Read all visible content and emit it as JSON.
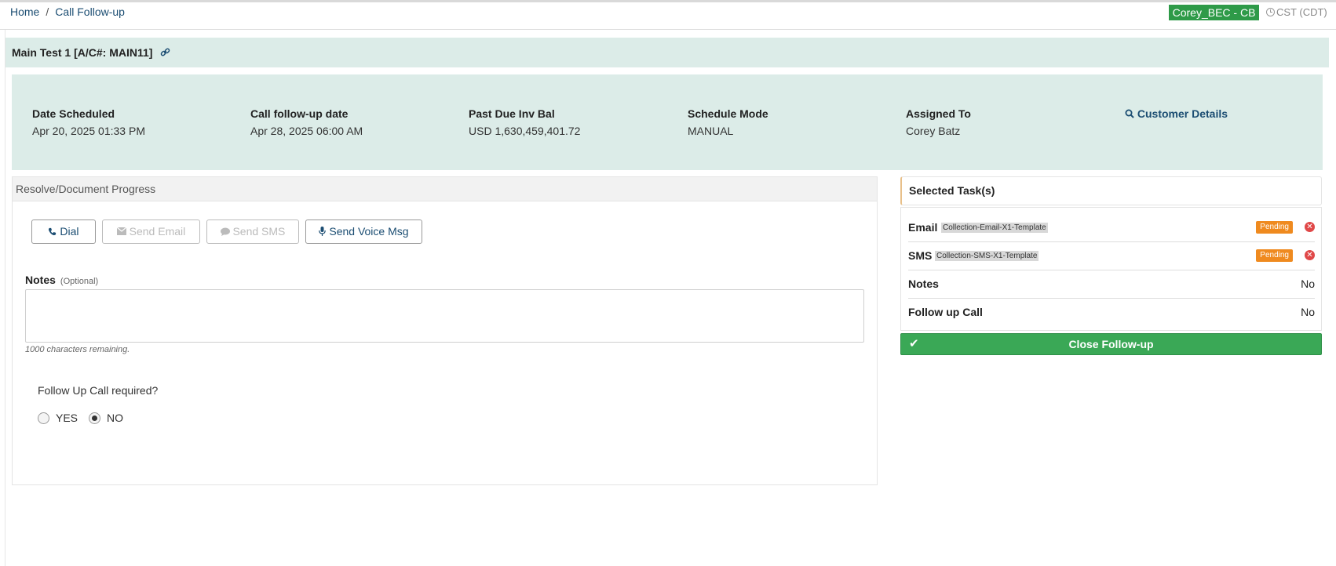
{
  "breadcrumb": {
    "home": "Home",
    "separator": "/",
    "current": "Call Follow-up"
  },
  "header": {
    "user_badge": "Corey_BEC - CB",
    "timezone": "CST (CDT)",
    "colors": {
      "badge": "#2e9a48"
    }
  },
  "account": {
    "title": "Main Test 1 [A/C#: MAIN11]"
  },
  "summary": {
    "date_scheduled_label": "Date Scheduled",
    "date_scheduled": "Apr 20, 2025 01:33 PM",
    "followup_date_label": "Call follow-up date",
    "followup_date": "Apr 28, 2025 06:00 AM",
    "past_due_label": "Past Due Inv Bal",
    "past_due": "USD 1,630,459,401.72",
    "schedule_mode_label": "Schedule Mode",
    "schedule_mode": "MANUAL",
    "assigned_to_label": "Assigned To",
    "assigned_to": "Corey Batz",
    "customer_details": "Customer Details"
  },
  "progress": {
    "heading": "Resolve/Document Progress",
    "buttons": {
      "dial": "Dial",
      "send_email": "Send Email",
      "send_sms": "Send SMS",
      "send_voice": "Send Voice Msg"
    },
    "notes_label": "Notes",
    "notes_optional": "(Optional)",
    "notes_value": "",
    "remaining": "1000 characters remaining.",
    "followup_question": "Follow Up Call required?",
    "yes": "YES",
    "no": "NO",
    "selected": "NO"
  },
  "tasks": {
    "heading": "Selected Task(s)",
    "email_label": "Email",
    "email_template": "Collection-Email-X1-Template",
    "email_status": "Pending",
    "sms_label": "SMS",
    "sms_template": "Collection-SMS-X1-Template",
    "sms_status": "Pending",
    "notes_label": "Notes",
    "notes_value": "No",
    "followup_label": "Follow up Call",
    "followup_value": "No",
    "close_button": "Close Follow-up"
  }
}
